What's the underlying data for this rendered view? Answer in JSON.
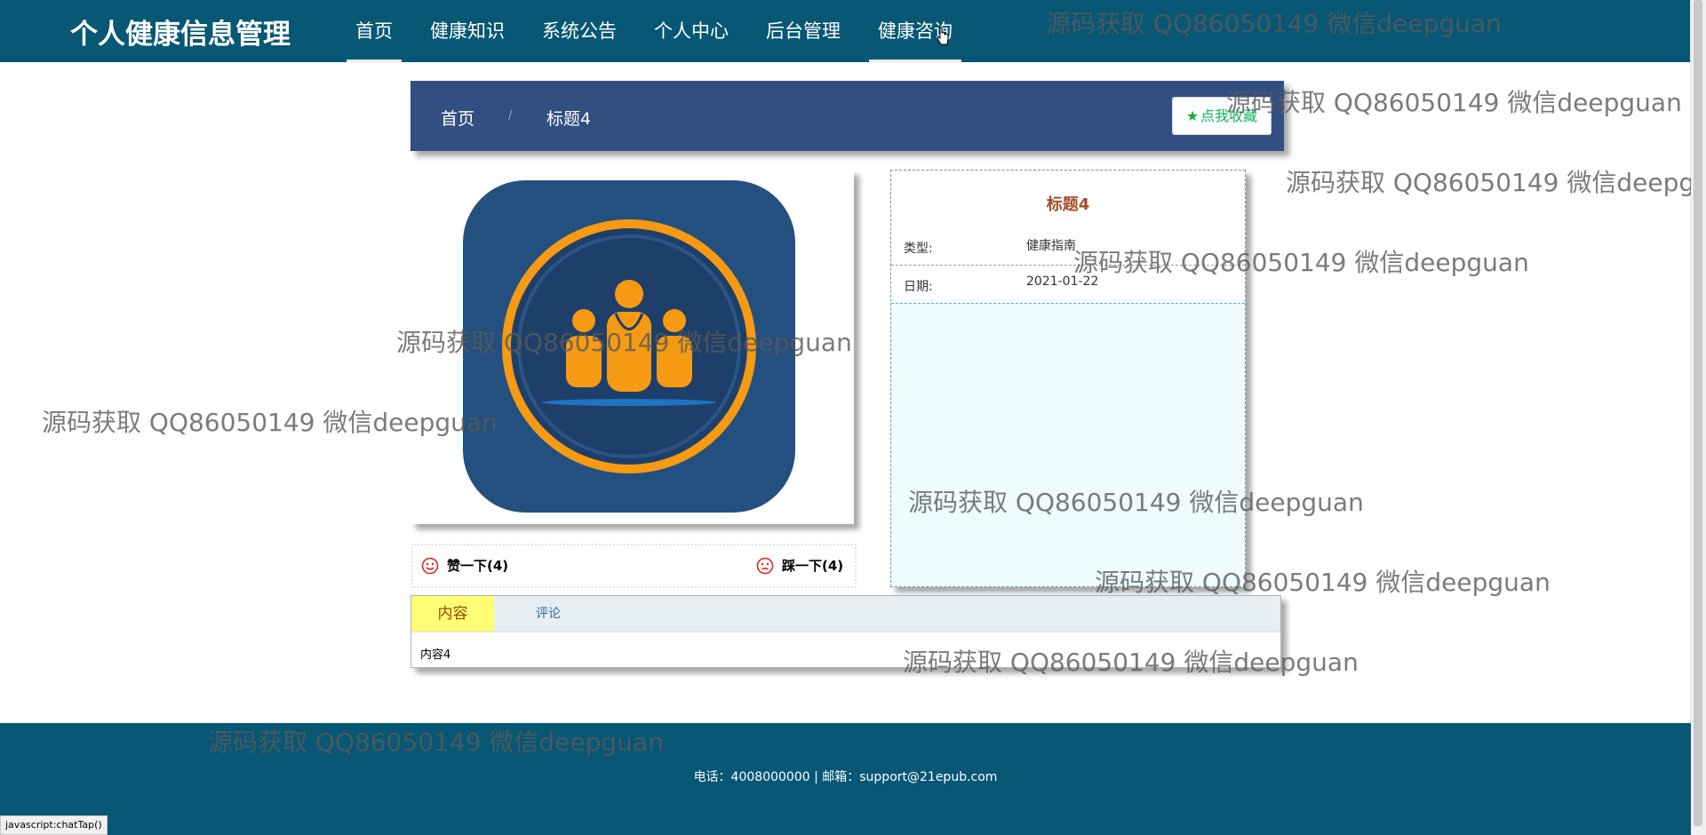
{
  "header": {
    "brand": "个人健康信息管理",
    "nav": [
      {
        "label": "首页"
      },
      {
        "label": "健康知识"
      },
      {
        "label": "系统公告"
      },
      {
        "label": "个人中心"
      },
      {
        "label": "后台管理"
      },
      {
        "label": "健康咨询"
      }
    ]
  },
  "breadcrumb": {
    "home": "首页",
    "separator": "/",
    "current": "标题4",
    "favorite_label": "点我收藏"
  },
  "likes": {
    "up_label": "赞一下(4)",
    "down_label": "踩一下(4)"
  },
  "info": {
    "title": "标题4",
    "type_label": "类型:",
    "type_value": "健康指南",
    "date_label": "日期:",
    "date_value": "2021-01-22"
  },
  "tabs": {
    "items": [
      {
        "label": "内容"
      },
      {
        "label": "评论"
      }
    ],
    "content": "内容4"
  },
  "footer": {
    "text": "电话：4008000000 | 邮箱：support@21epub.com"
  },
  "statusbar": "javascript:chatTap()",
  "watermark": "源码获取 QQ86050149 微信deepguan",
  "colors": {
    "header_bg": "#075775",
    "crumb_bg": "#314f81",
    "info_bg": "#eefcfe",
    "active_tab_bg": "#fffd73",
    "logo_orange": "#f59a12",
    "logo_blue": "#23507f"
  }
}
